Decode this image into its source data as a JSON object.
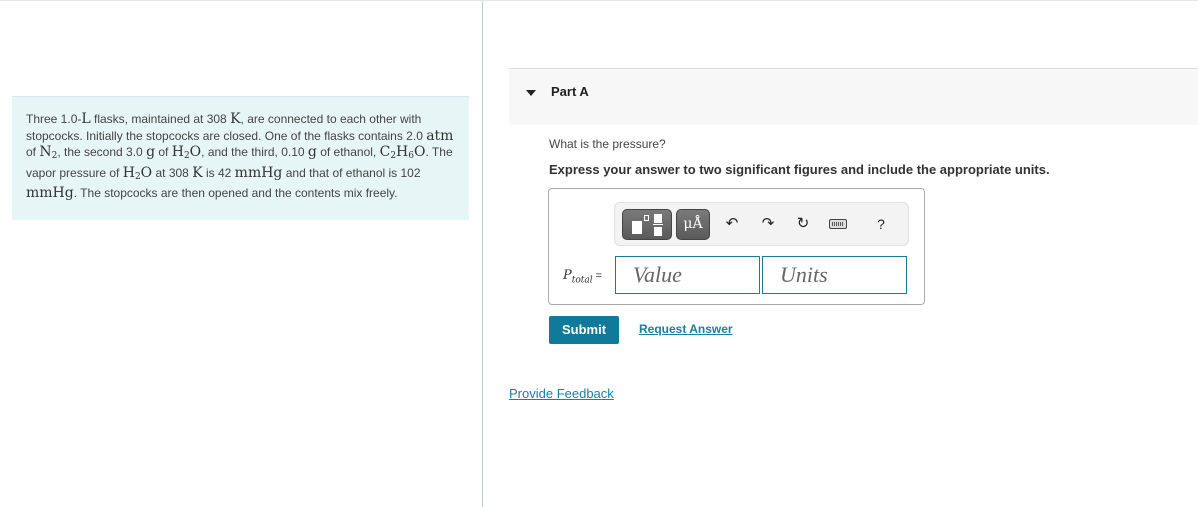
{
  "problem": {
    "segments": [
      {
        "t": "Three 1.0-"
      },
      {
        "m": "L"
      },
      {
        "t": " flasks, maintained at 308 "
      },
      {
        "m": "K"
      },
      {
        "t": ", are connected to each other with stopcocks. Initially the stopcocks are closed. One of the flasks contains 2.0 "
      },
      {
        "m": "atm"
      },
      {
        "t": " of "
      },
      {
        "m": "N",
        "sub": "2"
      },
      {
        "t": ", the second 3.0 "
      },
      {
        "m": "g"
      },
      {
        "t": " of "
      },
      {
        "m": "H",
        "sub": "2",
        "after": "O"
      },
      {
        "t": ", and the third, 0.10 "
      },
      {
        "m": "g"
      },
      {
        "t": " of ethanol, "
      },
      {
        "m": "C",
        "sub": "2",
        "after": "H",
        "sub2": "6",
        "after2": "O"
      },
      {
        "t": ". The vapor pressure of "
      },
      {
        "m": "H",
        "sub": "2",
        "after": "O"
      },
      {
        "t": " at 308 "
      },
      {
        "m": "K"
      },
      {
        "t": " is 42 "
      },
      {
        "m": "mmHg"
      },
      {
        "t": " and that of ethanol is 102 "
      },
      {
        "m": "mmHg"
      },
      {
        "t": ". The stopcocks are then opened and the contents mix freely."
      }
    ]
  },
  "part": {
    "title": "Part A",
    "question": "What is the pressure?",
    "instructions": "Express your answer to two significant figures and include the appropriate units."
  },
  "toolbar": {
    "units_label": "μÅ",
    "undo_icon": "↶",
    "redo_icon": "↷",
    "reset_icon": "↻",
    "help_label": "?"
  },
  "answer": {
    "variable": "P",
    "variable_sub": "total",
    "equals": "=",
    "value_placeholder": "Value",
    "units_placeholder": "Units",
    "value": "",
    "units": ""
  },
  "actions": {
    "submit_label": "Submit",
    "request_answer_label": "Request Answer",
    "feedback_label": "Provide Feedback"
  },
  "colors": {
    "accent": "#0f7a99",
    "link": "#1a7fa1",
    "problem_bg": "#e6f5f6"
  }
}
